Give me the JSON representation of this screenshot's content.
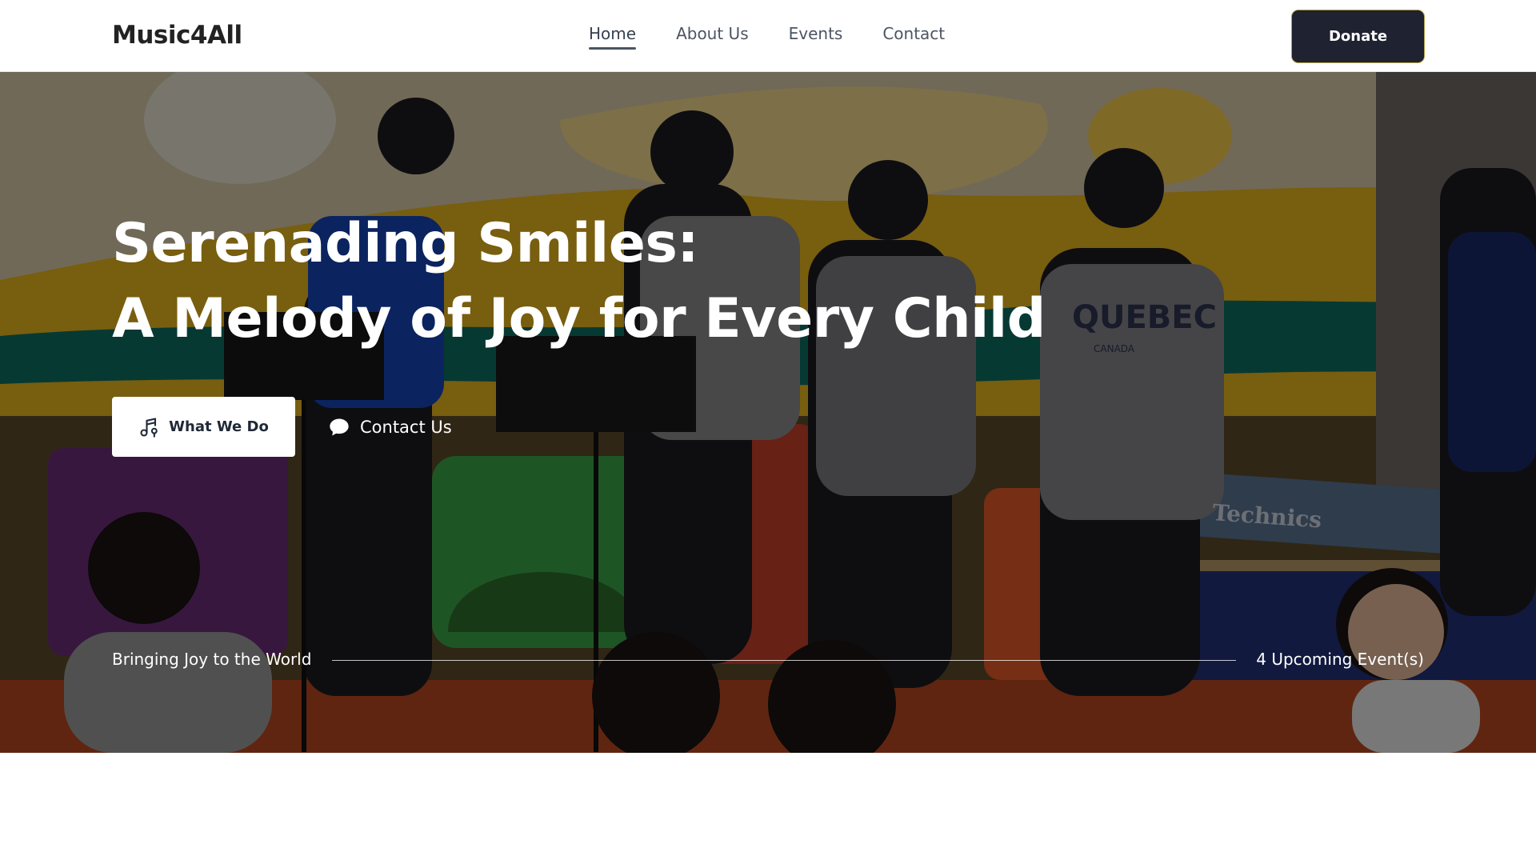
{
  "header": {
    "brand": "Music4All",
    "nav": [
      {
        "label": "Home",
        "active": true
      },
      {
        "label": "About Us",
        "active": false
      },
      {
        "label": "Events",
        "active": false
      },
      {
        "label": "Contact",
        "active": false
      }
    ],
    "donate_label": "Donate"
  },
  "hero": {
    "title_line1": "Serenading Smiles:",
    "title_line2": "A Melody of Joy for Every Child",
    "primary_button": {
      "label": "What We Do",
      "icon": "music-note-icon"
    },
    "secondary_button": {
      "label": "Contact Us",
      "icon": "chat-bubble-icon"
    },
    "tagline": "Bringing Joy to the World",
    "events_count": "4 Upcoming Event(s)",
    "photo_keyboard_brand": "Technics",
    "photo_hoodie_text": "QUEBEC",
    "photo_hoodie_subtext": "CANADA"
  },
  "colors": {
    "donate_bg": "#1f2230",
    "overlay": "rgba(0,0,0,0.48)",
    "text_on_hero": "#ffffff"
  }
}
